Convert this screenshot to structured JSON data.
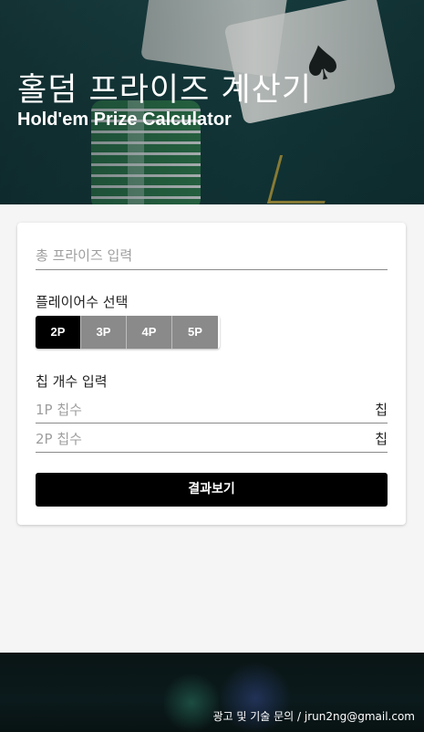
{
  "header": {
    "title": "홀덤 프라이즈 계산기",
    "subtitle": "Hold'em Prize Calculator"
  },
  "form": {
    "prize_placeholder": "총 프라이즈 입력",
    "players_label": "플레이어수 선택",
    "player_options": [
      "2P",
      "3P",
      "4P",
      "5P"
    ],
    "selected_players": "2P",
    "chips_label": "칩 개수 입력",
    "chip_rows": [
      {
        "placeholder": "1P 칩수",
        "unit": "칩"
      },
      {
        "placeholder": "2P 칩수",
        "unit": "칩"
      }
    ],
    "submit_label": "결과보기"
  },
  "footer": {
    "contact": "광고 및 기술 문의 / jrun2ng@gmail.com"
  },
  "colors": {
    "primary": "#000000",
    "inactive_button": "#8a8a8a",
    "background": "#f5f5f5"
  }
}
